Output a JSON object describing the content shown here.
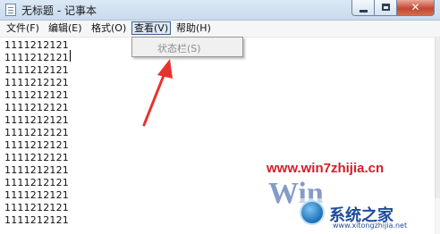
{
  "window": {
    "title": "无标题 - 记事本",
    "close_glyph": "✕"
  },
  "menu": {
    "items": [
      "文件(F)",
      "编辑(E)",
      "格式(O)",
      "查看(V)",
      "帮助(H)"
    ],
    "active_index": 3
  },
  "dropdown": {
    "items": [
      {
        "label": "状态栏(S)",
        "enabled": false
      }
    ]
  },
  "editor": {
    "lines": [
      "1111212121",
      "1111212121",
      "1111212121",
      "1111212121",
      "1111212121",
      "1111212121",
      "1111212121",
      "1111212121",
      "1111212121",
      "1111212121",
      "1111212121",
      "1111212121",
      "1111212121",
      "1111212121",
      "1111212121"
    ]
  },
  "watermark": {
    "url": "www.win7zhijia.cn",
    "win_text": "Win",
    "brand": "系统之家",
    "sub": "www.xitongzhijia.net"
  },
  "colors": {
    "arrow": "#e8322e",
    "watermark_url": "#d0202a",
    "watermark_brand": "#1f4c9b"
  }
}
